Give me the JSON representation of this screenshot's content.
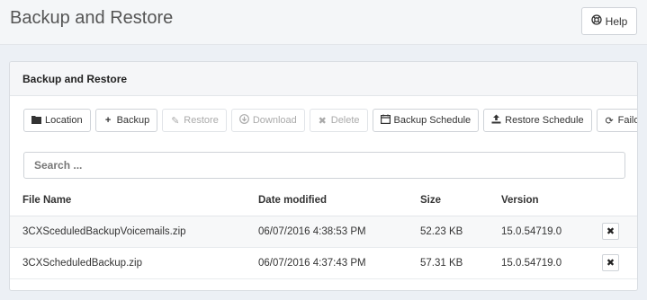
{
  "page": {
    "title": "Backup and Restore"
  },
  "header": {
    "help_label": "Help",
    "help_icon": "life-ring-icon"
  },
  "panel": {
    "title": "Backup and Restore"
  },
  "toolbar": {
    "location": "Location",
    "backup": "Backup",
    "restore": "Restore",
    "download": "Download",
    "delete": "Delete",
    "backup_schedule": "Backup Schedule",
    "restore_schedule": "Restore Schedule",
    "failover": "Failover"
  },
  "search": {
    "placeholder": "Search ..."
  },
  "table": {
    "headers": [
      "File Name",
      "Date modified",
      "Size",
      "Version"
    ],
    "rows": [
      {
        "file": "3CXSceduledBackupVoicemails.zip",
        "date": "06/07/2016 4:38:53 PM",
        "size": "52.23 KB",
        "version": "15.0.54719.0"
      },
      {
        "file": "3CXScheduledBackup.zip",
        "date": "06/07/2016 4:37:43 PM",
        "size": "57.31 KB",
        "version": "15.0.54719.0"
      }
    ]
  },
  "colors": {
    "background": "#ecf0f5",
    "disabled_text": "#aaaaaa"
  }
}
